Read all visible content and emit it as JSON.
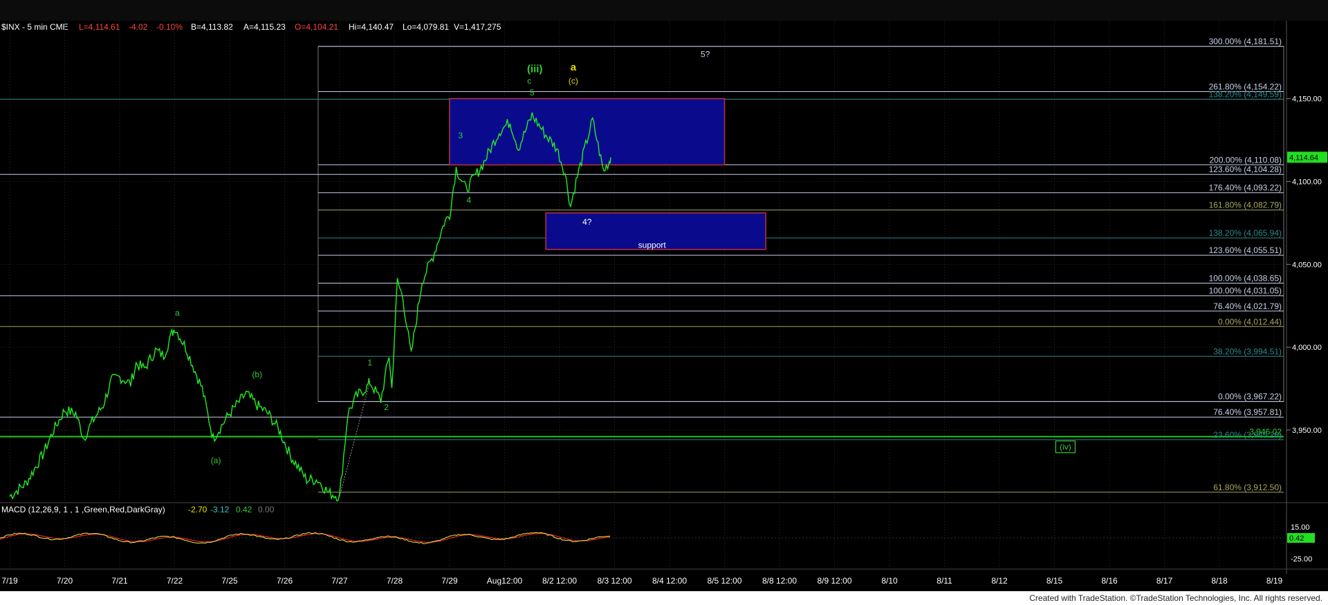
{
  "header": {
    "symbol": "$INX - 5 min  CME",
    "last": "L=4,114.61",
    "change": "-4.02",
    "pct": "-0.10%",
    "bid": "B=4,113.82",
    "ask": "A=4,115.23",
    "open": "O=4,104.21",
    "hi": "Hi=4,140.47",
    "lo": "Lo=4,079.81",
    "vol": "V=1,417,275"
  },
  "macd": {
    "label": "MACD (12,26,9, 1 , 1 ,Green,Red,DarkGray)",
    "v1": "-2.70",
    "v2": "-3.12",
    "v3": "0.42",
    "v4": "0.00",
    "ticks": [
      "15.00",
      "-25.00"
    ],
    "current": "0.42"
  },
  "footer": {
    "credit": "Created with TradeStation. ©TradeStation Technologies, Inc. All rights reserved."
  },
  "chart_data": {
    "type": "line",
    "title": "$INX - 5 min",
    "x_labels": [
      "7/19",
      "7/20",
      "7/21",
      "7/22",
      "7/25",
      "7/26",
      "7/27",
      "7/28",
      "7/29",
      "Aug12:00",
      "8/2 12:00",
      "8/3 12:00",
      "8/4 12:00",
      "8/5 12:00",
      "8/8 12:00",
      "8/9 12:00",
      "8/10",
      "8/11",
      "8/12",
      "8/15",
      "8/16",
      "8/17",
      "8/18",
      "8/19"
    ],
    "y_ticks": [
      "4,150.00",
      "4,100.00",
      "4,050.00",
      "4,000.00",
      "3,950.00"
    ],
    "ylim": [
      3907,
      4197
    ],
    "current_price": "4,114.64",
    "price_points": [
      [
        0,
        3910
      ],
      [
        0.3,
        3918
      ],
      [
        0.6,
        3935
      ],
      [
        0.8,
        3950
      ],
      [
        1.0,
        3962
      ],
      [
        1.2,
        3960
      ],
      [
        1.35,
        3945
      ],
      [
        1.5,
        3955
      ],
      [
        1.7,
        3965
      ],
      [
        1.85,
        3980
      ],
      [
        2.0,
        3982
      ],
      [
        2.2,
        3978
      ],
      [
        2.3,
        3990
      ],
      [
        2.45,
        3987
      ],
      [
        2.65,
        3998
      ],
      [
        2.8,
        3995
      ],
      [
        2.95,
        4008
      ],
      [
        3.0,
        4012
      ],
      [
        3.2,
        4000
      ],
      [
        3.5,
        3975
      ],
      [
        3.7,
        3945
      ],
      [
        3.8,
        3950
      ],
      [
        4.0,
        3960
      ],
      [
        4.3,
        3972
      ],
      [
        4.5,
        3965
      ],
      [
        4.7,
        3960
      ],
      [
        4.9,
        3950
      ],
      [
        5.1,
        3935
      ],
      [
        5.4,
        3920
      ],
      [
        5.6,
        3920
      ],
      [
        5.8,
        3912
      ],
      [
        6.0,
        3910
      ],
      [
        6.15,
        3960
      ],
      [
        6.3,
        3970
      ],
      [
        6.5,
        3976
      ],
      [
        6.55,
        3979
      ],
      [
        6.75,
        3968
      ],
      [
        6.9,
        3995
      ],
      [
        6.95,
        3975
      ],
      [
        7.05,
        4040
      ],
      [
        7.15,
        4030
      ],
      [
        7.3,
        3995
      ],
      [
        7.5,
        4040
      ],
      [
        7.7,
        4055
      ],
      [
        7.9,
        4075
      ],
      [
        8.0,
        4080
      ],
      [
        8.12,
        4108
      ],
      [
        8.3,
        4095
      ],
      [
        8.6,
        4110
      ],
      [
        8.9,
        4130
      ],
      [
        9.1,
        4136
      ],
      [
        9.25,
        4120
      ],
      [
        9.5,
        4140
      ],
      [
        9.75,
        4128
      ],
      [
        9.95,
        4120
      ],
      [
        10.1,
        4105
      ],
      [
        10.2,
        4085
      ],
      [
        10.3,
        4100
      ],
      [
        10.5,
        4125
      ],
      [
        10.6,
        4137
      ],
      [
        10.7,
        4122
      ],
      [
        10.8,
        4106
      ],
      [
        10.9,
        4112
      ],
      [
        10.93,
        4114.6
      ]
    ],
    "fib_levels": [
      {
        "label": "300.00% (4,181.51)",
        "value": 4181.51,
        "color": "#c8d0e8"
      },
      {
        "label": "261.80% (4,154.22)",
        "value": 4154.22,
        "color": "#c8d0e8"
      },
      {
        "label": "138.20% (4,149.59)",
        "value": 4149.59,
        "color": "#2e8a8c"
      },
      {
        "label": "200.00% (4,110.08)",
        "value": 4110.08,
        "color": "#c8d0e8"
      },
      {
        "label": "123.60% (4,104.28)",
        "value": 4104.28,
        "color": "#c8d0e8"
      },
      {
        "label": "176.40% (4,093.22)",
        "value": 4093.22,
        "color": "#c8d0e8"
      },
      {
        "label": "161.80% (4,082.79)",
        "value": 4082.79,
        "color": "#a8a860"
      },
      {
        "label": "138.20% (4,065.94)",
        "value": 4065.94,
        "color": "#2e8a8c"
      },
      {
        "label": "123.60% (4,055.51)",
        "value": 4055.51,
        "color": "#c8d0e8"
      },
      {
        "label": "100.00% (4,038.65)",
        "value": 4038.65,
        "color": "#c8d0e8"
      },
      {
        "label": "100.00% (4,031.05)",
        "value": 4031.05,
        "color": "#c8d0e8"
      },
      {
        "label": "76.40% (4,021.79)",
        "value": 4021.79,
        "color": "#c8d0e8"
      },
      {
        "label": "0.00% (4,012.44)",
        "value": 4012.44,
        "color": "#a8a860"
      },
      {
        "label": "38.20% (3,994.51)",
        "value": 3994.51,
        "color": "#2e8a8c"
      },
      {
        "label": "0.00% (3,967.22)",
        "value": 3967.22,
        "color": "#c8d0e8"
      },
      {
        "label": "76.40% (3,957.81)",
        "value": 3957.81,
        "color": "#c8d0e8"
      },
      {
        "label": "3,946.02",
        "value": 3946.02,
        "color": "#22cc22"
      },
      {
        "label": "23.60% (3,945.28)",
        "value": 3944.2,
        "color": "#2e8a8c"
      },
      {
        "label": "61.80% (3,912.50)",
        "value": 3912.5,
        "color": "#a8a860"
      }
    ],
    "zones": [
      {
        "label": "",
        "x0": 8.0,
        "x1": 13.0,
        "y0": 4110,
        "y1": 4150
      },
      {
        "label": "support",
        "x0": 9.75,
        "x1": 13.75,
        "y0": 4059,
        "y1": 4081
      }
    ],
    "wave_labels": [
      {
        "text": "a",
        "x": 3.05,
        "y": 4019,
        "color": "#33cc33"
      },
      {
        "text": "(b)",
        "x": 4.5,
        "y": 3982,
        "color": "#33cc33"
      },
      {
        "text": "(a)",
        "x": 3.75,
        "y": 3930,
        "color": "#33cc33"
      },
      {
        "text": "1",
        "x": 6.55,
        "y": 3989,
        "color": "#33cc33"
      },
      {
        "text": "2",
        "x": 6.85,
        "y": 3962,
        "color": "#33cc33"
      },
      {
        "text": "3",
        "x": 8.2,
        "y": 4126,
        "color": "#33cc33"
      },
      {
        "text": "4",
        "x": 8.35,
        "y": 4087,
        "color": "#33cc33"
      },
      {
        "text": "c",
        "x": 9.45,
        "y": 4159,
        "color": "#33cc33"
      },
      {
        "text": "5",
        "x": 9.5,
        "y": 4152,
        "color": "#33cc33"
      },
      {
        "text": "(iii)",
        "x": 9.55,
        "y": 4166,
        "color": "#33cc33"
      },
      {
        "text": "a",
        "x": 10.25,
        "y": 4167,
        "color": "#e8d800"
      },
      {
        "text": "(c)",
        "x": 10.25,
        "y": 4159,
        "color": "#e8d800"
      },
      {
        "text": "4?",
        "x": 10.5,
        "y": 4074,
        "color": "#ffffff"
      },
      {
        "text": "5?",
        "x": 12.65,
        "y": 4175,
        "color": "#c8d0e8"
      },
      {
        "text": "(iv)",
        "x": 19.2,
        "y": 3938,
        "color": "#33cc33"
      }
    ]
  }
}
